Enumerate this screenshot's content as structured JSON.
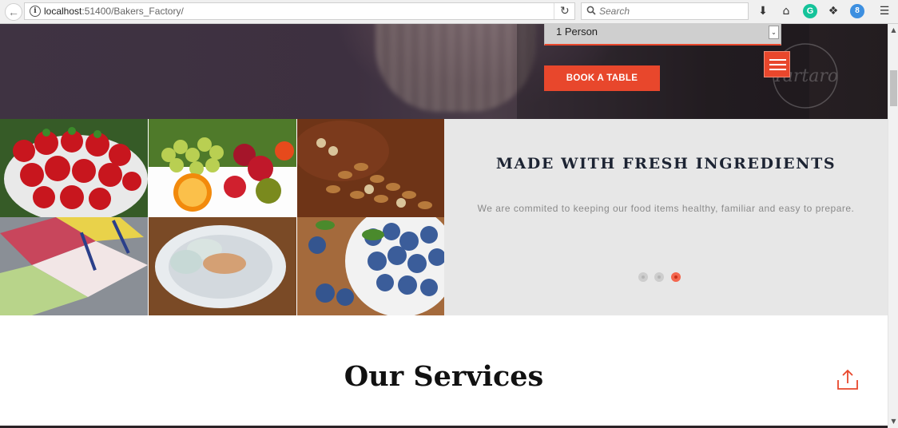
{
  "browser": {
    "url_host": "localhost",
    "url_rest": ":51400/Bakers_Factory/",
    "search_placeholder": "Search",
    "icons": [
      "back-arrow-icon",
      "info-icon",
      "reload-icon",
      "search-icon",
      "download-icon",
      "home-icon",
      "grammarly-icon",
      "extension-icon",
      "blue-extension-icon",
      "hamburger-menu-icon"
    ]
  },
  "hero": {
    "person_select_value": "1 Person",
    "book_button_label": "BOOK A TABLE",
    "logo_text": "Tartaro",
    "accent_color": "#e8472c"
  },
  "gallery": {
    "tiles": [
      "strawberries",
      "mixed-fruits",
      "nuts",
      "ice-cream",
      "eggs",
      "blueberries"
    ]
  },
  "fresh": {
    "title": "MADE WITH FRESH INGREDIENTS",
    "text": "We are commited to keeping our food items healthy, familiar and easy to prepare.",
    "slider_total": 3,
    "slider_active": 3
  },
  "services": {
    "title": "Our Services"
  }
}
